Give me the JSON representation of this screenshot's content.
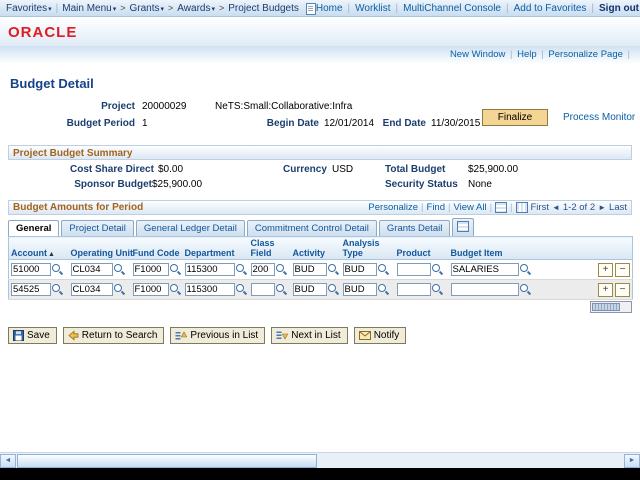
{
  "chrome": {
    "brand": "ORACLE",
    "breadcrumb": {
      "favorites": "Favorites",
      "main_menu": "Main Menu",
      "trail": [
        "Grants",
        "Awards",
        "Project Budgets"
      ]
    },
    "utility_links": [
      "Home",
      "Worklist",
      "MultiChannel Console",
      "Add to Favorites"
    ],
    "signout": "Sign out",
    "page_links": [
      "New Window",
      "Help",
      "Personalize Page"
    ]
  },
  "page": {
    "title": "Budget Detail",
    "fields": {
      "project_label": "Project",
      "project_id": "20000029",
      "project_desc": "NeTS:Small:Collaborative:Infra",
      "budget_period_label": "Budget Period",
      "budget_period": "1",
      "begin_date_label": "Begin Date",
      "begin_date": "12/01/2014",
      "end_date_label": "End Date",
      "end_date": "11/30/2015"
    },
    "finalize_button": "Finalize",
    "process_monitor": "Process Monitor"
  },
  "summary": {
    "title": "Project Budget Summary",
    "cost_share_label": "Cost Share Direct",
    "cost_share": "$0.00",
    "currency_label": "Currency",
    "currency": "USD",
    "total_budget_label": "Total Budget",
    "total_budget": "$25,900.00",
    "sponsor_budget_label": "Sponsor Budget",
    "sponsor_budget": "$25,900.00",
    "security_status_label": "Security Status",
    "security_status": "None"
  },
  "grid": {
    "title": "Budget Amounts for Period",
    "links": {
      "personalize": "Personalize",
      "find": "Find",
      "view_all": "View All"
    },
    "pager": {
      "first": "First",
      "range": "1-2 of 2",
      "last": "Last"
    },
    "tabs": [
      {
        "label": "General"
      },
      {
        "label": "Project Detail"
      },
      {
        "label": "General Ledger Detail"
      },
      {
        "label": "Commitment Control Detail"
      },
      {
        "label": "Grants Detail"
      }
    ],
    "columns": [
      "Account",
      "Operating Unit",
      "Fund Code",
      "Department",
      "Class Field",
      "Activity",
      "Analysis Type",
      "Product",
      "Budget Item"
    ],
    "rows": [
      {
        "account": "51000",
        "operating_unit": "CL034",
        "fund_code": "F1000",
        "department": "115300",
        "class_field": "200",
        "activity": "BUD",
        "analysis_type": "BUD",
        "product": "",
        "budget_item": "SALARIES"
      },
      {
        "account": "54525",
        "operating_unit": "CL034",
        "fund_code": "F1000",
        "department": "115300",
        "class_field": "",
        "activity": "BUD",
        "analysis_type": "BUD",
        "product": "",
        "budget_item": ""
      }
    ]
  },
  "toolbar": {
    "save": "Save",
    "return_to_search": "Return to Search",
    "previous_in_list": "Previous in List",
    "next_in_list": "Next in List",
    "notify": "Notify"
  },
  "icons": {
    "dropdown": "▾",
    "sort_asc": "▲",
    "prev": "◄",
    "next": "►",
    "add": "+",
    "remove": "−",
    "scroll_left": "◄",
    "scroll_right": "►"
  }
}
